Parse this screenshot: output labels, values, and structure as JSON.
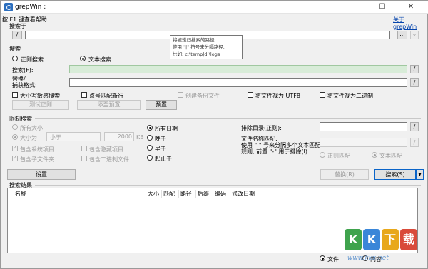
{
  "window": {
    "title": "grepWin :",
    "minimize_glyph": "─",
    "maximize_glyph": "☐",
    "close_glyph": "✕"
  },
  "header": {
    "help_hint": "按 F1 键查看帮助",
    "about_link": "关于 grepWin"
  },
  "search_in": {
    "label": "搜索于",
    "path_button": "/",
    "browse_button": "...",
    "dropdown_glyph": "⌄",
    "tooltip": [
      "将被递归搜索的路径.",
      "使用 \"|\" 符号来分隔路径.",
      "比如: c:\\temp|d:\\logs"
    ]
  },
  "search": {
    "group_label": "搜索",
    "regex_label": "正则搜索",
    "text_label": "文本搜索",
    "search_for_label": "搜索(F):",
    "replace_label_1": "替换/",
    "replace_label_2": "捕获格式:",
    "slash_button": "/",
    "case_label": "大小写敏感搜索",
    "dot_newline_label": "点号匹配新行",
    "backup_label": "创建备份文件",
    "utf8_label": "将文件视为 UTF8",
    "binary_label": "将文件视为二进制",
    "test_regex_button": "测试正则",
    "add_preset_button": "添至预置",
    "presets_button": "预置"
  },
  "limit": {
    "group_label": "限制搜索",
    "all_sizes_label": "所有大小",
    "size_is_label": "大小为",
    "size_op": "小于",
    "size_value": "2000",
    "size_unit": "KB",
    "all_dates_label": "所有日期",
    "newer_label": "晚于",
    "older_label": "早于",
    "between_label": "起止于",
    "include_system_label": "包含系统项目",
    "include_hidden_label": "包含隐藏项目",
    "include_subfolders_label": "包含子文件夹",
    "include_binary_label": "包含二进制文件",
    "exclude_dirs_label": "排除目录(正则):",
    "file_match_1": "文件名称匹配:",
    "file_match_2": "使用 \"|\" 号来分隔多个文本匹配",
    "file_match_3": "规则, 前置 \"-\" 用于排除(I)",
    "file_regex_label": "正则匹配",
    "file_text_label": "文本匹配"
  },
  "actions": {
    "settings_button": "设置",
    "replace_button": "替换(R)",
    "search_button": "搜索(S)",
    "search_dropdown": "▾"
  },
  "results": {
    "group_label": "搜索结果",
    "columns": [
      "名称",
      "大小",
      "匹配",
      "路径",
      "后缀",
      "编码",
      "修改日期"
    ],
    "file_label": "文件",
    "content_label": "内容"
  },
  "watermark": {
    "letters": [
      "K",
      "K",
      "下",
      "载"
    ],
    "colors": [
      "#3fa34d",
      "#3a86d8",
      "#e8a81b",
      "#d94a3a"
    ],
    "url": "www.kkx.net"
  }
}
